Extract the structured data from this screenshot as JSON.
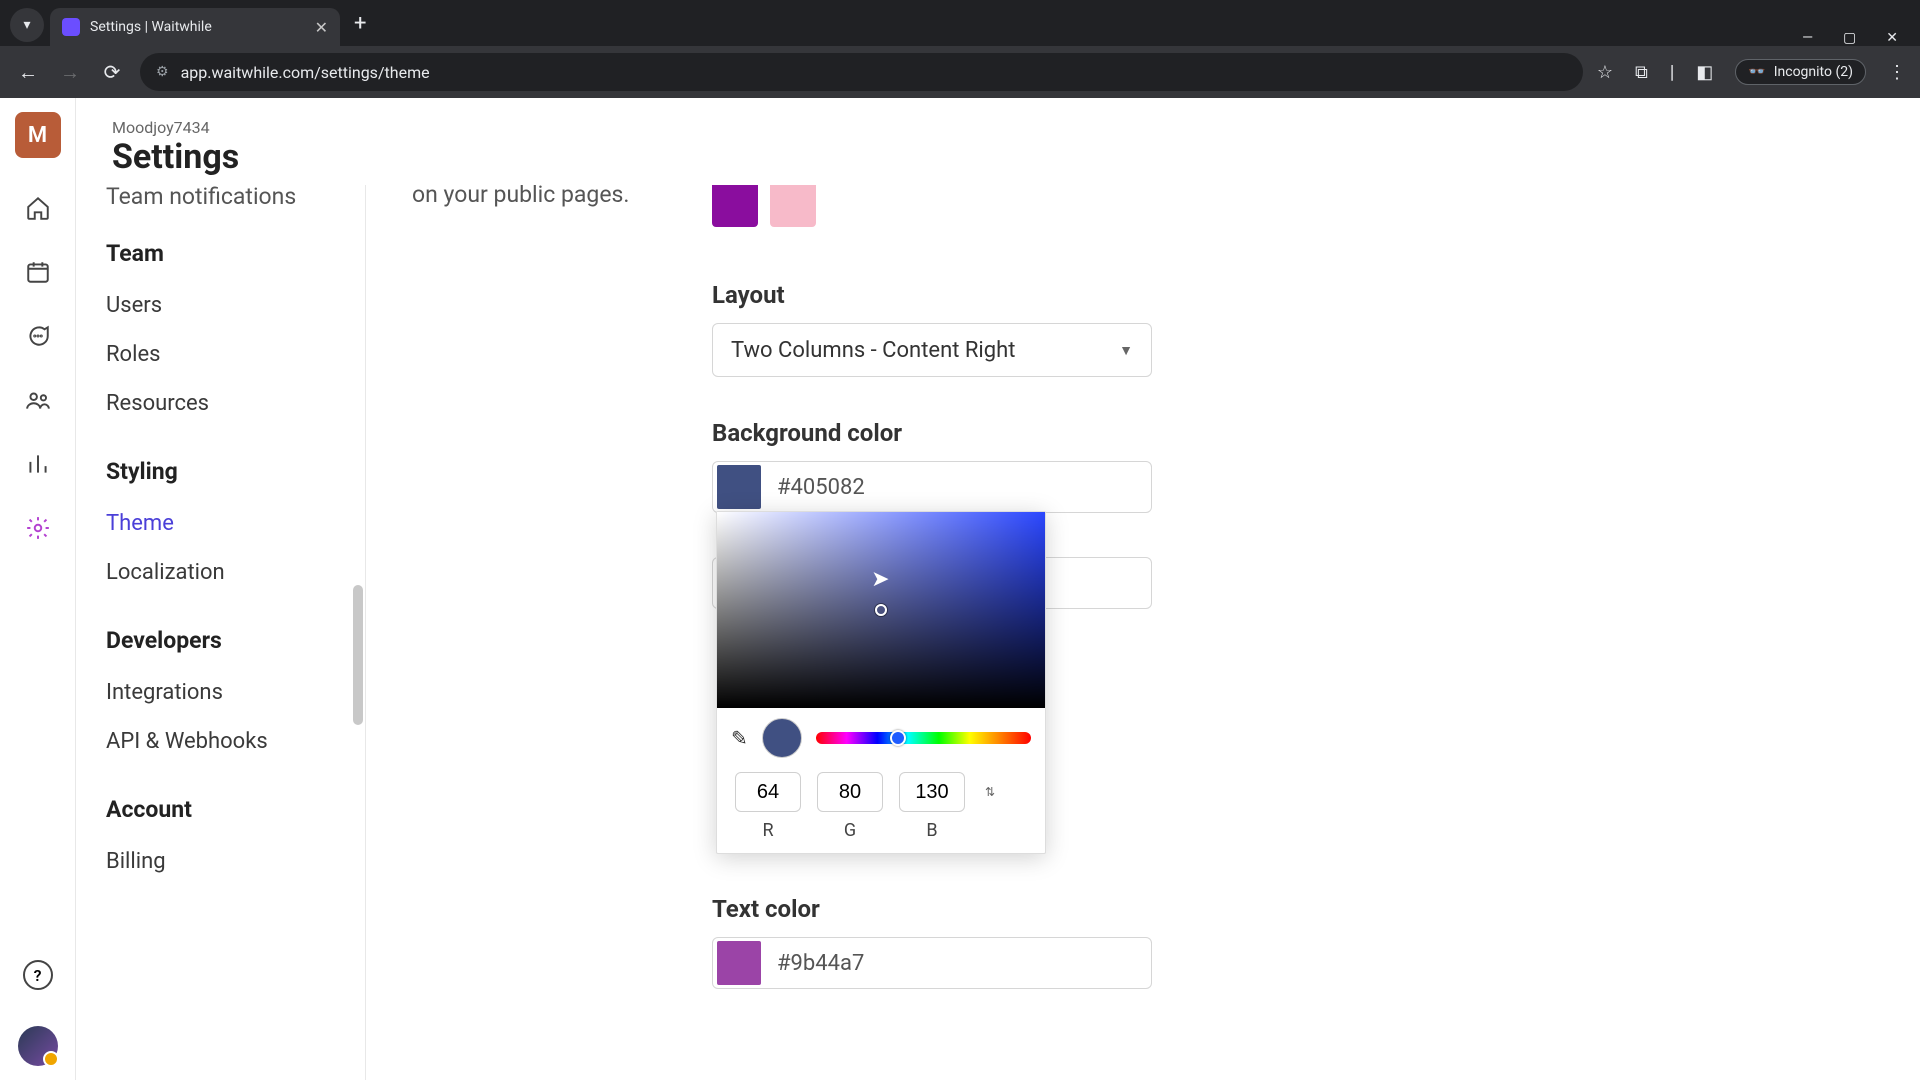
{
  "browser": {
    "tab_title": "Settings | Waitwhile",
    "url": "app.waitwhile.com/settings/theme",
    "incognito_label": "Incognito (2)"
  },
  "header": {
    "workspace": "Moodjoy7434",
    "page_title": "Settings",
    "avatar_initial": "M"
  },
  "sidenav": {
    "cutoff_item": "Team notifications",
    "groups": [
      {
        "title": "Team",
        "items": [
          "Users",
          "Roles",
          "Resources"
        ]
      },
      {
        "title": "Styling",
        "items": [
          "Theme",
          "Localization"
        ],
        "active_index": 0
      },
      {
        "title": "Developers",
        "items": [
          "Integrations",
          "API & Webhooks"
        ]
      },
      {
        "title": "Account",
        "items": [
          "Billing"
        ]
      }
    ]
  },
  "main": {
    "description_tail": "on your public pages.",
    "swatch_colors": [
      "#8a0d9e",
      "#f7bac9"
    ],
    "layout": {
      "label": "Layout",
      "value": "Two Columns - Content Right"
    },
    "bgcolor": {
      "label": "Background color",
      "hex": "#405082",
      "chip": "#405082"
    },
    "textcolor": {
      "label": "Text color",
      "hex": "#9b44a7",
      "chip": "#9b44a7"
    }
  },
  "picker": {
    "r": "64",
    "g": "80",
    "b": "130",
    "r_label": "R",
    "g_label": "G",
    "b_label": "B"
  }
}
